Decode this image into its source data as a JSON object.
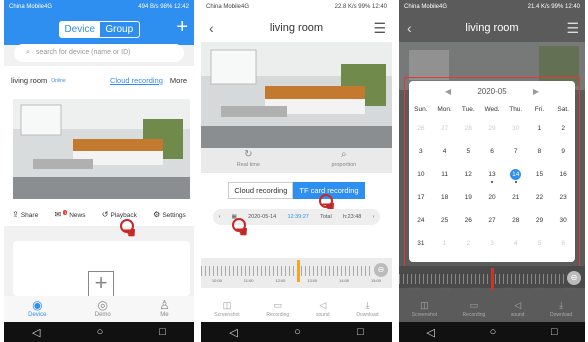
{
  "colors": {
    "accent": "#2f8ff0",
    "highlight": "#e53935",
    "playhead": "#f5a623"
  },
  "p1": {
    "status_left": "China Mobile4G",
    "status_right": "494 B/s 98% 12:42",
    "seg_device": "Device",
    "seg_group": "Group",
    "plus": "+",
    "search_placeholder": "search for device (name or ID)",
    "room_name": "living room",
    "online": "Online",
    "cloud": "Cloud recording",
    "more": "More",
    "share": "Share",
    "news": "News",
    "news_badge": "1",
    "playback": "Playback",
    "settings": "Settings",
    "nav_device": "Device",
    "nav_demo": "Demo",
    "nav_me": "Me"
  },
  "p2": {
    "status_left": "China Mobile4G",
    "status_right": "22.8 K/s 99% 12:40",
    "title": "living room",
    "realtime": "Real time",
    "proportion": "proportion",
    "tab_cloud": "Cloud recording",
    "tab_tf": "TF card recording",
    "date": "2020-05-14",
    "time": "12:39:27",
    "total": "Total",
    "duration": "h:23:48",
    "ticks": [
      "10:00",
      "11:00",
      "12:00",
      "13:00",
      "14:00",
      "15:00"
    ],
    "screenshot": "Screenshot",
    "recording": "Recording",
    "sound": "sound",
    "download": "Download"
  },
  "p3": {
    "status_left": "China Mobile4G",
    "status_right": "21.4 K/s 99% 12:40",
    "title": "living room",
    "month": "2020-05",
    "weekdays": [
      "Sun.",
      "Mon.",
      "Tue.",
      "Wed.",
      "Thu.",
      "Fri.",
      "Sat."
    ],
    "weeks": [
      [
        "26",
        "27",
        "28",
        "29",
        "30",
        "1",
        "2"
      ],
      [
        "3",
        "4",
        "5",
        "6",
        "7",
        "8",
        "9"
      ],
      [
        "10",
        "11",
        "12",
        "13",
        "14",
        "15",
        "16"
      ],
      [
        "17",
        "18",
        "19",
        "20",
        "21",
        "22",
        "23"
      ],
      [
        "24",
        "25",
        "26",
        "27",
        "28",
        "29",
        "30"
      ],
      [
        "31",
        "1",
        "2",
        "3",
        "4",
        "5",
        "6"
      ]
    ],
    "ticks": [
      "10:00",
      "11:00",
      "12:00",
      "13:00",
      "14:00",
      "15:00"
    ],
    "screenshot": "Screenshot",
    "recording": "Recording",
    "sound": "sound",
    "download": "Download"
  }
}
